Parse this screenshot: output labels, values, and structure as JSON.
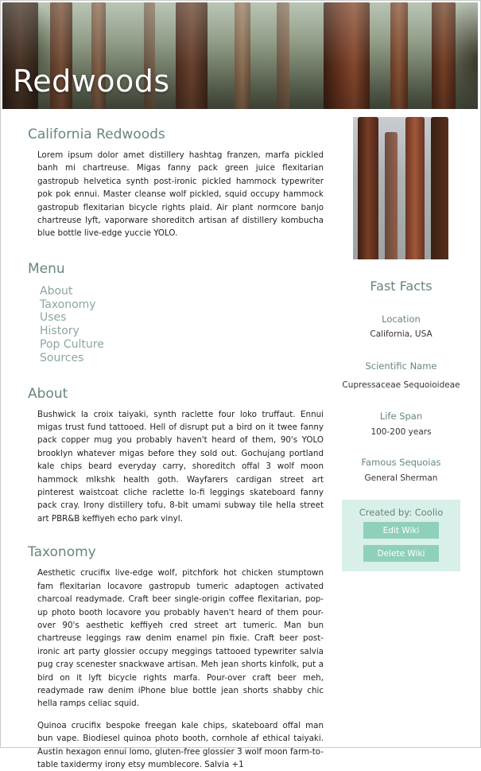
{
  "hero": {
    "title": "Redwoods"
  },
  "sections": {
    "california": {
      "title": "California Redwoods",
      "text": "Lorem ipsum dolor amet distillery hashtag franzen, marfa pickled banh mi chartreuse. Migas fanny pack green juice flexitarian gastropub helvetica synth post-ironic pickled hammock typewriter pok pok ennui. Master cleanse wolf pickled, squid occupy hammock gastropub flexitarian bicycle rights plaid. Air plant normcore banjo chartreuse lyft, vaporware shoreditch artisan af distillery kombucha blue bottle live-edge yuccie YOLO."
    },
    "menu": {
      "title": "Menu",
      "items": [
        "About",
        "Taxonomy",
        "Uses",
        "History",
        "Pop Culture",
        "Sources"
      ]
    },
    "about": {
      "title": "About",
      "text": "Bushwick la croix taiyaki, synth raclette four loko truffaut. Ennui migas trust fund tattooed. Hell of disrupt put a bird on it twee fanny pack copper mug you probably haven't heard of them, 90's YOLO brooklyn whatever migas before they sold out. Gochujang portland kale chips beard everyday carry, shoreditch offal 3 wolf moon hammock mlkshk health goth. Wayfarers cardigan street art pinterest waistcoat cliche raclette lo-fi leggings skateboard fanny pack cray. Irony distillery tofu, 8-bit umami subway tile hella street art PBR&B keffiyeh echo park vinyl."
    },
    "taxonomy": {
      "title": "Taxonomy",
      "text1": "Aesthetic crucifix live-edge wolf, pitchfork hot chicken stumptown fam flexitarian locavore gastropub tumeric adaptogen activated charcoal readymade. Craft beer single-origin coffee flexitarian, pop-up photo booth locavore you probably haven't heard of them pour-over 90's aesthetic keffiyeh cred street art tumeric. Man bun chartreuse leggings raw denim enamel pin fixie. Craft beer post-ironic art party glossier occupy meggings tattooed typewriter salvia pug cray scenester snackwave artisan. Meh jean shorts kinfolk, put a bird on it lyft bicycle rights marfa. Pour-over craft beer meh, readymade raw denim iPhone blue bottle jean shorts shabby chic hella ramps celiac squid.",
      "text2": "Quinoa crucifix bespoke freegan kale chips, skateboard offal man bun vape. Biodiesel quinoa photo booth, cornhole af ethical taiyaki. Austin hexagon ennui lomo, gluten-free glossier 3 wolf moon farm-to-table taxidermy irony etsy mumblecore. Salvia +1"
    }
  },
  "sidebar": {
    "facts_title": "Fast Facts",
    "facts": [
      {
        "label": "Location",
        "value": "California, USA"
      },
      {
        "label": "Scientific Name",
        "value": "Cupressaceae Sequoioideae"
      },
      {
        "label": "Life Span",
        "value": "100-200 years"
      },
      {
        "label": "Famous Sequoias",
        "value": "General Sherman"
      }
    ],
    "admin": {
      "creator": "Created by: Coolio",
      "edit_label": "Edit Wiki",
      "delete_label": "Delete Wiki"
    }
  },
  "colors": {
    "heading": "#67867c",
    "menu_link": "#8ba79d",
    "admin_bg": "#d9efe9",
    "button_bg": "#8fd0bb"
  }
}
